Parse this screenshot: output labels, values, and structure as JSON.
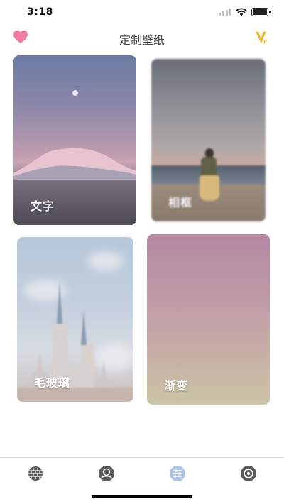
{
  "status_bar": {
    "time": "3:18",
    "icons": [
      "signal-icon",
      "wifi-icon",
      "battery-icon"
    ]
  },
  "header": {
    "title": "定制壁纸",
    "left_icon": "heart-icon",
    "right_icon": "vip-icon",
    "vip_text": "VIP"
  },
  "cards": [
    {
      "label": "文字"
    },
    {
      "label": "相框"
    },
    {
      "label": "毛玻璃"
    },
    {
      "label": "渐变"
    }
  ],
  "tab_bar": {
    "tabs": [
      {
        "icon": "brick-wall-icon",
        "active": false
      },
      {
        "icon": "avatar-icon",
        "active": false
      },
      {
        "icon": "sliders-icon",
        "active": true
      },
      {
        "icon": "settings-ring-icon",
        "active": false
      }
    ]
  },
  "colors": {
    "accent_heart": "#f07aa0",
    "accent_vip": "#e7b52c",
    "tab_inactive": "#5a5a5a",
    "tab_active": "#a9c4e4"
  }
}
